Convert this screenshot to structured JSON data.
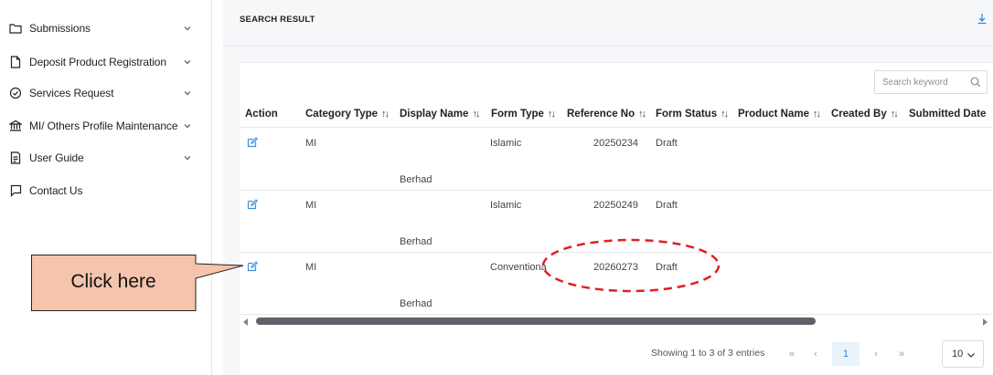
{
  "sidebar": {
    "items": [
      {
        "label": "Submissions",
        "icon": "folder-icon",
        "has_chevron": true
      },
      {
        "label": "Deposit Product Registration",
        "icon": "document-icon",
        "has_chevron": true
      },
      {
        "label": "Services Request",
        "icon": "badge-icon",
        "has_chevron": true
      },
      {
        "label": "MI/ Others Profile Maintenance",
        "icon": "bank-icon",
        "has_chevron": true
      },
      {
        "label": "User Guide",
        "icon": "guide-icon",
        "has_chevron": true
      },
      {
        "label": "Contact Us",
        "icon": "chat-icon",
        "has_chevron": false
      }
    ]
  },
  "main": {
    "title": "SEARCH RESULT",
    "search": {
      "placeholder": "Search keyword",
      "value": ""
    },
    "columns": [
      "Action",
      "Category Type",
      "Display Name",
      "Form Type",
      "Reference No",
      "Form Status",
      "Product Name",
      "Created By",
      "Submitted Date"
    ],
    "rows": [
      {
        "category": "MI",
        "display_name": "Berhad",
        "form_type": "Islamic",
        "reference_no": "20250234",
        "form_status": "Draft"
      },
      {
        "category": "MI",
        "display_name": "Berhad",
        "form_type": "Islamic",
        "reference_no": "20250249",
        "form_status": "Draft"
      },
      {
        "category": "MI",
        "display_name": "Berhad",
        "form_type": "Conventiona",
        "reference_no": "20260273",
        "form_status": "Draft"
      }
    ],
    "pagination": {
      "info": "Showing 1 to 3 of 3 entries",
      "first": "«",
      "prev": "‹",
      "current_page": "1",
      "next": "›",
      "last": "»",
      "page_size": "10"
    }
  },
  "annotation": {
    "callout_text": "Click here",
    "callout_fill": "#f4c4ad",
    "highlight_color": "#e02020"
  },
  "colors": {
    "accent": "#3c8fe0",
    "sort_icon": "↑↓"
  }
}
